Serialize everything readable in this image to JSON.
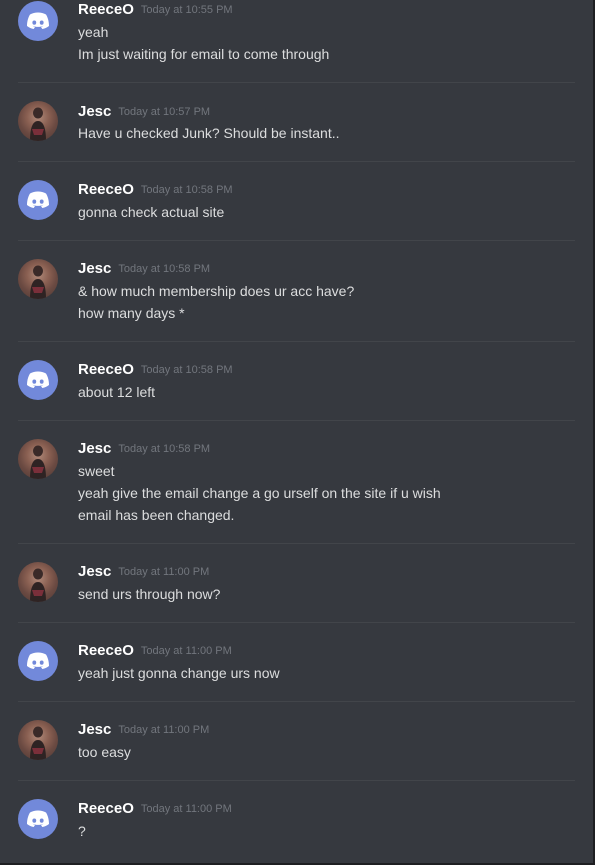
{
  "messages": [
    {
      "author": "ReeceO",
      "avatar": "discord-logo-icon",
      "timestamp": "Today at 10:55 PM",
      "lines": [
        "yeah",
        "Im just waiting for email to come through"
      ]
    },
    {
      "author": "Jesc",
      "avatar": "user-photo",
      "timestamp": "Today at 10:57 PM",
      "lines": [
        "Have u checked Junk? Should be instant.."
      ]
    },
    {
      "author": "ReeceO",
      "avatar": "discord-logo-icon",
      "timestamp": "Today at 10:58 PM",
      "lines": [
        "gonna check actual site"
      ]
    },
    {
      "author": "Jesc",
      "avatar": "user-photo",
      "timestamp": "Today at 10:58 PM",
      "lines": [
        "& how much membership does ur acc have?",
        "how many days *"
      ]
    },
    {
      "author": "ReeceO",
      "avatar": "discord-logo-icon",
      "timestamp": "Today at 10:58 PM",
      "lines": [
        "about 12 left"
      ]
    },
    {
      "author": "Jesc",
      "avatar": "user-photo",
      "timestamp": "Today at 10:58 PM",
      "lines": [
        "sweet",
        "yeah give the email change a go urself on the site if u wish",
        "email has been changed."
      ]
    },
    {
      "author": "Jesc",
      "avatar": "user-photo",
      "timestamp": "Today at 11:00 PM",
      "lines": [
        "send urs through now?"
      ]
    },
    {
      "author": "ReeceO",
      "avatar": "discord-logo-icon",
      "timestamp": "Today at 11:00 PM",
      "lines": [
        "yeah just gonna change urs now"
      ]
    },
    {
      "author": "Jesc",
      "avatar": "user-photo",
      "timestamp": "Today at 11:00 PM",
      "lines": [
        "too easy"
      ]
    },
    {
      "author": "ReeceO",
      "avatar": "discord-logo-icon",
      "timestamp": "Today at 11:00 PM",
      "lines": [
        "?"
      ]
    }
  ],
  "colors": {
    "background": "#36393f",
    "discord_blurple": "#7289da",
    "username": "#ffffff",
    "timestamp": "#72767d",
    "message_text": "#dcddde",
    "divider": "#42454a"
  }
}
